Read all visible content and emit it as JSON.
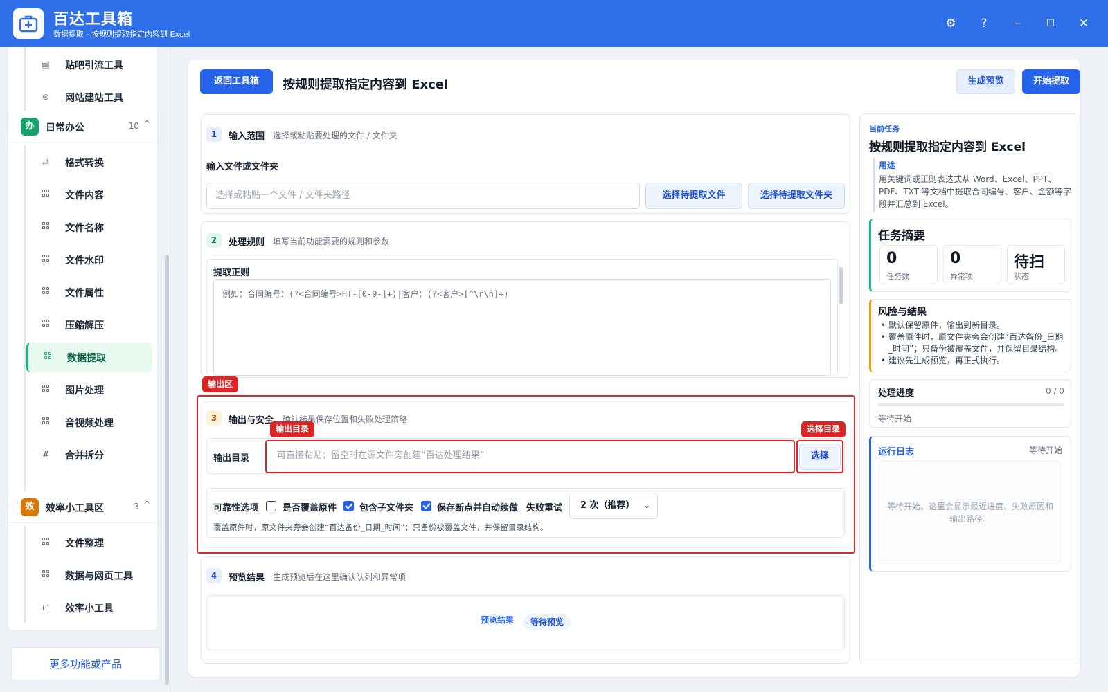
{
  "app": {
    "title": "百达工具箱",
    "subtitle": "数据提取 - 按规则提取指定内容到 Excel",
    "controls": {
      "settings": "⚙",
      "help": "?",
      "minimize": "–",
      "maximize": "☐",
      "close": "✕"
    }
  },
  "sidebar": {
    "top_items": [
      {
        "label": "贴吧引流工具",
        "icon": "document-icon"
      },
      {
        "label": "网站建站工具",
        "icon": "globe-icon"
      }
    ],
    "categories": [
      {
        "badge": "办",
        "badge_color": "#15a36b",
        "name": "日常办公",
        "count": "10",
        "caret": "^",
        "items": [
          {
            "label": "格式转换",
            "icon": "swap-icon"
          },
          {
            "label": "文件内容",
            "icon": "grid-icon"
          },
          {
            "label": "文件名称",
            "icon": "grid-icon"
          },
          {
            "label": "文件水印",
            "icon": "grid-icon"
          },
          {
            "label": "文件属性",
            "icon": "grid-icon"
          },
          {
            "label": "压缩解压",
            "icon": "grid-icon"
          },
          {
            "label": "数据提取",
            "icon": "grid-icon",
            "active": true
          },
          {
            "label": "图片处理",
            "icon": "grid-icon"
          },
          {
            "label": "音视频处理",
            "icon": "grid-icon"
          },
          {
            "label": "合并拆分",
            "icon": "hash-icon"
          }
        ]
      },
      {
        "badge": "效",
        "badge_color": "#d97706",
        "name": "效率小工具区",
        "count": "3",
        "caret": "^",
        "items": [
          {
            "label": "文件整理",
            "icon": "grid-icon"
          },
          {
            "label": "数据与网页工具",
            "icon": "grid-icon"
          },
          {
            "label": "效率小工具",
            "icon": "toolbox-icon"
          }
        ]
      }
    ],
    "more_label": "更多功能或产品"
  },
  "header": {
    "back_label": "返回工具箱",
    "title": "按规则提取指定内容到 Excel",
    "preview_label": "生成预览",
    "start_label": "开始提取"
  },
  "section1": {
    "no": "1",
    "title": "输入范围",
    "desc": "选择或粘贴要处理的文件 / 文件夹",
    "field_label": "输入文件或文件夹",
    "input_placeholder": "选择或粘贴一个文件 / 文件夹路径",
    "btn_file": "选择待提取文件",
    "btn_folder": "选择待提取文件夹"
  },
  "section2": {
    "no": "2",
    "title": "处理规则",
    "desc": "填写当前功能需要的规则和参数",
    "field_label": "提取正则",
    "textarea_placeholder": "例如：合同编号：(?<合同编号>HT-[0-9-]+)|客户：(?<客户>[^\\r\\n]+)"
  },
  "section3": {
    "tag": "输出区",
    "no": "3",
    "title": "输出与安全",
    "desc": "确认结果保存位置和失败处理策略",
    "dir_tag": "输出目录",
    "choose_tag": "选择目录",
    "dir_label": "输出目录",
    "dir_placeholder": "可直接粘贴；留空时在源文件旁创建“百达处理结果”",
    "choose_btn": "选择",
    "options_label": "可靠性选项",
    "overwrite_label": "是否覆盖原件",
    "overwrite_checked": false,
    "subfolder_label": "包含子文件夹",
    "subfolder_checked": true,
    "resume_label": "保存断点并自动续做",
    "resume_checked": true,
    "retry_label": "失败重试",
    "retry_value": "2 次（推荐）",
    "note": "覆盖原件时，原文件夹旁会创建“百达备份_日期_时间”；只备份被覆盖文件，并保留目录结构。"
  },
  "section4": {
    "no": "4",
    "title": "预览结果",
    "desc": "生成预览后在这里确认队列和异常项",
    "preview_label": "预览结果",
    "preview_badge": "等待预览"
  },
  "right_panel": {
    "current_label": "当前任务",
    "task_title": "按规则提取指定内容到 Excel",
    "usage_label": "用途",
    "usage_text": "用关键词或正则表达式从 Word、Excel、PPT、PDF、TXT 等文档中提取合同编号、客户、金额等字段并汇总到 Excel。",
    "summary_title": "任务摘要",
    "stats": [
      {
        "value": "0",
        "label": "任务数"
      },
      {
        "value": "0",
        "label": "异常项"
      },
      {
        "value": "待扫",
        "label": "状态"
      }
    ],
    "risk_title": "风险与结果",
    "risk_items": [
      "默认保留原件，输出到新目录。",
      "覆盖原件时，原文件夹旁会创建“百达备份_日期_时间”；只备份被覆盖文件，并保留目录结构。",
      "建议先生成预览，再正式执行。"
    ],
    "progress_title": "处理进度",
    "progress_count": "0 / 0",
    "progress_fraction": 0,
    "progress_status": "等待开始",
    "log_title": "运行日志",
    "log_status": "等待开始",
    "log_text": "等待开始。这里会显示最近进度、失败原因和输出路径。"
  },
  "colors": {
    "primary": "#2f6fe8",
    "accent_blue": "#2563eb",
    "active_green": "#10b981",
    "highlight_red": "#dc2626",
    "warning_orange": "#f59e0b"
  }
}
